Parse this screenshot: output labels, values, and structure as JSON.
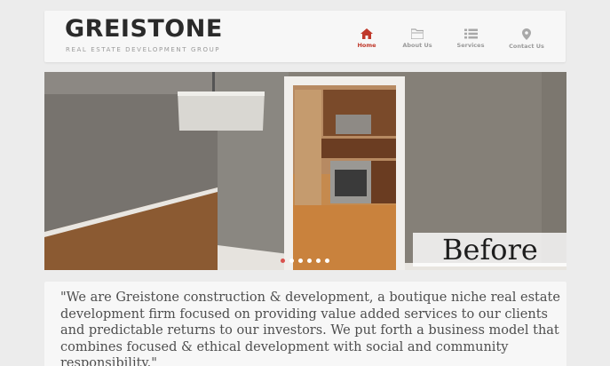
{
  "brand": {
    "name": "GREISTONE",
    "tagline": "REAL ESTATE DEVELOPMENT GROUP"
  },
  "nav": {
    "items": [
      {
        "label": "Home",
        "icon": "home-icon",
        "active": true
      },
      {
        "label": "About Us",
        "icon": "folder-icon",
        "active": false
      },
      {
        "label": "Services",
        "icon": "list-icon",
        "active": false
      },
      {
        "label": "Contact Us",
        "icon": "map-pin-icon",
        "active": false
      }
    ]
  },
  "slider": {
    "caption": "Before",
    "slide_count": 6,
    "active_index": 0
  },
  "intro": {
    "quote": "\"We are Greistone construction & development, a boutique niche real estate development firm focused on providing value added services to our clients and predictable returns to our investors. We put forth a business model that combines focused & ethical development with social and community responsibility.\""
  },
  "colors": {
    "accent": "#c0392b",
    "nav_text": "#9a9a9a",
    "page_bg": "#ececec",
    "panel_bg": "#f7f7f7"
  }
}
